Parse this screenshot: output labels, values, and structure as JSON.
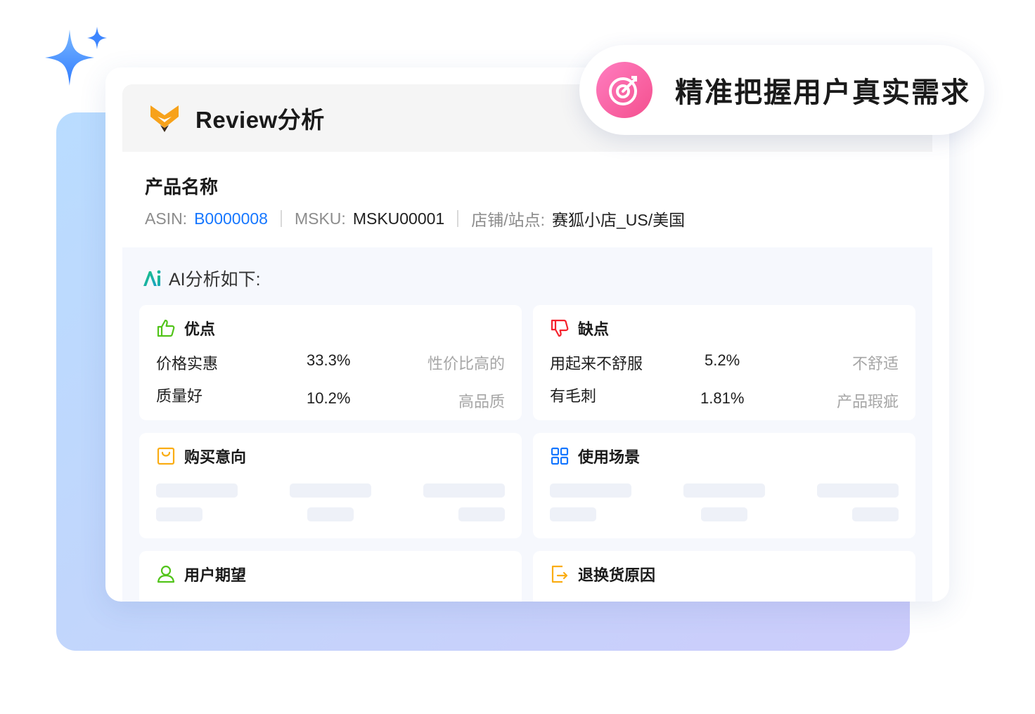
{
  "card": {
    "title": "Review分析",
    "product_name": "产品名称",
    "meta": {
      "asin_label": "ASIN:",
      "asin_value": "B0000008",
      "msku_label": "MSKU:",
      "msku_value": "MSKU00001",
      "store_label": "店铺/站点:",
      "store_value": "赛狐小店_US/美国"
    }
  },
  "analysis": {
    "title": "AI分析如下:",
    "pros": {
      "title": "优点",
      "rows": [
        {
          "label": "价格实惠",
          "percent": "33.3%",
          "tag": "性价比高的"
        },
        {
          "label": "质量好",
          "percent": "10.2%",
          "tag": "高品质"
        }
      ]
    },
    "cons": {
      "title": "缺点",
      "rows": [
        {
          "label": "用起来不舒服",
          "percent": "5.2%",
          "tag": "不舒适"
        },
        {
          "label": "有毛刺",
          "percent": "1.81%",
          "tag": "产品瑕疵"
        }
      ]
    },
    "purchase_intent": {
      "title": "购买意向"
    },
    "usage_scenario": {
      "title": "使用场景"
    },
    "user_expectation": {
      "title": "用户期望"
    },
    "return_reason": {
      "title": "退换货原因"
    }
  },
  "callout": {
    "text": "精准把握用户真实需求"
  },
  "colors": {
    "accent_blue": "#1677ff",
    "pros_green": "#52c41a",
    "cons_red": "#f5222d",
    "intent_orange": "#faad14",
    "scenario_blue": "#1677ff",
    "callout_pink": "#f759ab"
  },
  "icons": {
    "logo": "fox-logo-icon",
    "ai": "ai-icon",
    "pros": "thumbs-up-icon",
    "cons": "thumbs-down-icon",
    "purchase_intent": "shopping-bag-icon",
    "usage_scenario": "grid-icon",
    "user_expectation": "user-icon",
    "return_reason": "return-icon",
    "callout": "target-icon",
    "sparkle": "sparkle-icon"
  }
}
